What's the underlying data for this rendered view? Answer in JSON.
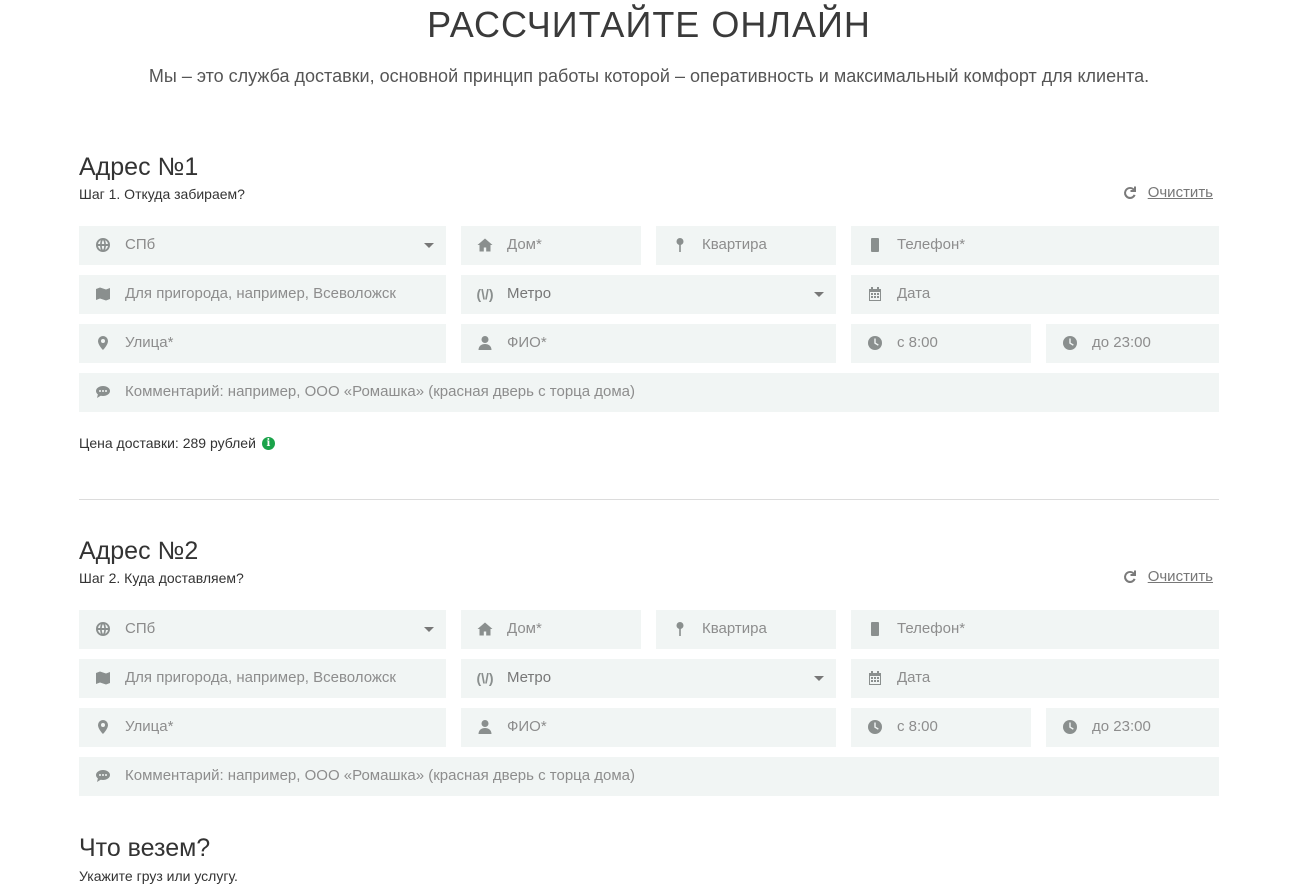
{
  "header": {
    "title": "РАССЧИТАЙТЕ ОНЛАЙН",
    "subtitle": "Мы – это служба доставки, основной принцип работы которой – оперативность и максимальный комфорт для клиента."
  },
  "addresses": [
    {
      "title": "Адрес №1",
      "step": "Шаг 1. Откуда забираем?",
      "clear_label": "Очистить",
      "city": "СПб",
      "house_placeholder": "Дом*",
      "apartment_placeholder": "Квартира",
      "phone_placeholder": "Телефон*",
      "suburb_placeholder": "Для пригорода, например, Всеволожск",
      "metro": "Метро",
      "date_placeholder": "Дата",
      "street_placeholder": "Улица*",
      "name_placeholder": "ФИО*",
      "time_from": "с 8:00",
      "time_to": "до 23:00",
      "comment_placeholder": "Комментарий: например, ООО «Ромашка» (красная дверь с торца дома)",
      "price": "Цена доставки: 289 рублей"
    },
    {
      "title": "Адрес №2",
      "step": "Шаг 2. Куда доставляем?",
      "clear_label": "Очистить",
      "city": "СПб",
      "house_placeholder": "Дом*",
      "apartment_placeholder": "Квартира",
      "phone_placeholder": "Телефон*",
      "suburb_placeholder": "Для пригорода, например, Всеволожск",
      "metro": "Метро",
      "date_placeholder": "Дата",
      "street_placeholder": "Улица*",
      "name_placeholder": "ФИО*",
      "time_from": "с 8:00",
      "time_to": "до 23:00",
      "comment_placeholder": "Комментарий: например, ООО «Ромашка» (красная дверь с торца дома)"
    }
  ],
  "cargo": {
    "title": "Что везем?",
    "subtitle": "Укажите груз или услугу."
  },
  "metro_icon_text": "(\\/)",
  "colors": {
    "field_bg": "#f1f5f4",
    "info_green": "#1aa34a"
  },
  "icons": [
    "globe-icon",
    "home-icon",
    "pin-icon",
    "phone-icon",
    "map-icon",
    "metro-icon",
    "calendar-icon",
    "marker-icon",
    "user-icon",
    "clock-icon",
    "comment-icon",
    "refresh-icon",
    "info-icon"
  ]
}
